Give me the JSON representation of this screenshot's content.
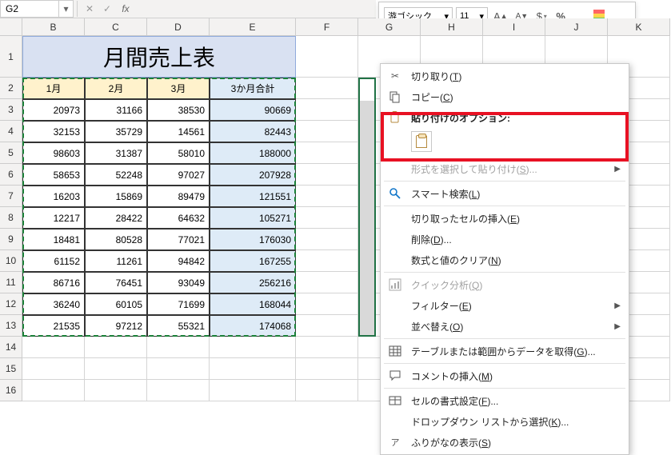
{
  "namebox": {
    "value": "G2"
  },
  "mini_toolbar": {
    "font_name": "游ゴシック",
    "font_size": "11"
  },
  "columns": [
    "B",
    "C",
    "D",
    "E",
    "F",
    "G",
    "H",
    "I",
    "J",
    "K"
  ],
  "col_widths": {
    "B": 78,
    "C": 78,
    "D": 78,
    "E": 108,
    "F": 78,
    "G": 78,
    "H": 78,
    "I": 78,
    "J": 78,
    "K": 78
  },
  "row_numbers": [
    1,
    2,
    3,
    4,
    5,
    6,
    7,
    8,
    9,
    10,
    11,
    12,
    13,
    14,
    15,
    16
  ],
  "title_cell": "月間売上表",
  "header_row": {
    "B": "1月",
    "C": "2月",
    "D": "3月",
    "E": "3か月合計"
  },
  "data_rows": [
    {
      "B": "20973",
      "C": "31166",
      "D": "38530",
      "E": "90669"
    },
    {
      "B": "32153",
      "C": "35729",
      "D": "14561",
      "E": "82443"
    },
    {
      "B": "98603",
      "C": "31387",
      "D": "58010",
      "E": "188000"
    },
    {
      "B": "58653",
      "C": "52248",
      "D": "97027",
      "E": "207928"
    },
    {
      "B": "16203",
      "C": "15869",
      "D": "89479",
      "E": "121551"
    },
    {
      "B": "12217",
      "C": "28422",
      "D": "64632",
      "E": "105271"
    },
    {
      "B": "18481",
      "C": "80528",
      "D": "77021",
      "E": "176030"
    },
    {
      "B": "61152",
      "C": "11261",
      "D": "94842",
      "E": "167255"
    },
    {
      "B": "86716",
      "C": "76451",
      "D": "93049",
      "E": "256216"
    },
    {
      "B": "36240",
      "C": "60105",
      "D": "71699",
      "E": "168044"
    },
    {
      "B": "21535",
      "C": "97212",
      "D": "55321",
      "E": "174068"
    }
  ],
  "context_menu": {
    "cut": "切り取り(<u>T</u>)",
    "copy": "コピー(<u>C</u>)",
    "paste_options_header": "貼り付けのオプション:",
    "paste_special": "形式を選択して貼り付け(<u>S</u>)...",
    "smart_lookup": "スマート検索(<u>L</u>)",
    "insert_cut": "切り取ったセルの挿入(<u>E</u>)",
    "delete": "削除(<u>D</u>)...",
    "clear": "数式と値のクリア(<u>N</u>)",
    "quick_analysis": "クイック分析(<u>Q</u>)",
    "filter": "フィルター(<u>E</u>)",
    "sort": "並べ替え(<u>O</u>)",
    "from_table": "テーブルまたは範囲からデータを取得(<u>G</u>)...",
    "insert_comment": "コメントの挿入(<u>M</u>)",
    "format_cells": "セルの書式設定(<u>F</u>)...",
    "dropdown_select": "ドロップダウン リストから選択(<u>K</u>)...",
    "furigana": "ふりがなの表示(<u>S</u>)"
  }
}
